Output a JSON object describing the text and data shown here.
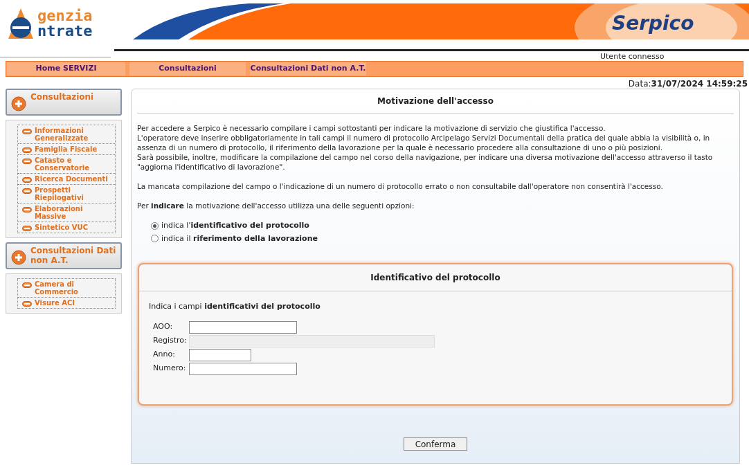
{
  "header": {
    "logo_line1": "genzia",
    "logo_line2": "ntrate",
    "app_name": "Serpico",
    "user_label": "Utente connesso"
  },
  "nav": [
    {
      "label": "Home SERVIZI"
    },
    {
      "label": "Consultazioni"
    },
    {
      "label": "Consultazioni Dati non A.T."
    }
  ],
  "date": {
    "label": "Data:",
    "value": "31/07/2024 14:59:25"
  },
  "sidebar": [
    {
      "title": "Consultazioni",
      "items": [
        "Informazioni Generalizzate",
        "Famiglia Fiscale",
        "Catasto e Conservatorie",
        "Ricerca Documenti",
        "Prospetti Riepilogativi",
        "Elaborazioni Massive",
        "Sintetico VUC"
      ]
    },
    {
      "title": "Consultazioni Dati non A.T.",
      "items": [
        "Camera di Commercio",
        "Visure ACI"
      ]
    }
  ],
  "main": {
    "title": "Motivazione dell'accesso",
    "intro": [
      "Per accedere a Serpico è necessario compilare i campi sottostanti per indicare la motivazione di servizio che giustifica l'accesso.",
      "L'operatore deve inserire obbligatoriamente in tali campi il numero di protocollo Arcipelago Servizi Documentali della pratica del quale abbia la visibilità o, in assenza di un numero di protocollo, il riferimento della lavorazione per la quale è necessario procedere alla consultazione di uno o più posizioni.",
      "Sarà possibile, inoltre, modificare la compilazione del campo nel corso della navigazione, per indicare una diversa motivazione dell'accesso attraverso il tasto \"aggiorna l'identificativo di lavorazione\"."
    ],
    "warning": "La mancata compilazione del campo o l'indicazione di un numero di protocollo errato o non consultabile dall'operatore non consentirà l'accesso.",
    "options_prompt": "Per **indicare** la motivazione dell'accesso utilizza una delle seguenti opzioni:",
    "options": [
      {
        "label": "indica l'**identificativo del protocollo**",
        "selected": true
      },
      {
        "label": "indica il **riferimento della lavorazione**",
        "selected": false
      }
    ],
    "protocol_panel": {
      "title": "Identificativo del protocollo",
      "instruction": "Indica i campi **identificativi del protocollo**",
      "fields": [
        {
          "label": "AOO:",
          "disabled": false
        },
        {
          "label": "Registro:",
          "disabled": true
        },
        {
          "label": "Anno:",
          "disabled": false
        },
        {
          "label": "Numero:",
          "disabled": false
        }
      ]
    },
    "confirm_button": "Conferma"
  }
}
